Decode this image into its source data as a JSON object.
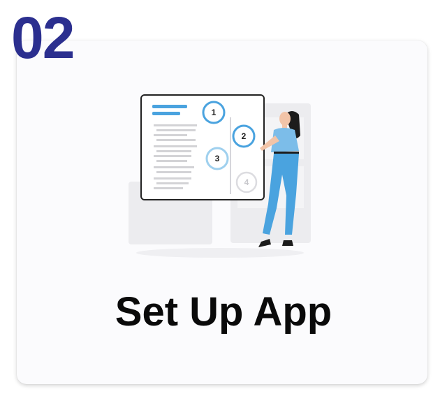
{
  "step": {
    "number": "02"
  },
  "card": {
    "title": "Set Up App"
  },
  "illustration": {
    "steps": [
      "1",
      "2",
      "3",
      "4"
    ]
  },
  "colors": {
    "step_number": "#2b2f8f",
    "accent_blue": "#4aa3df",
    "title": "#0a0a0a"
  }
}
